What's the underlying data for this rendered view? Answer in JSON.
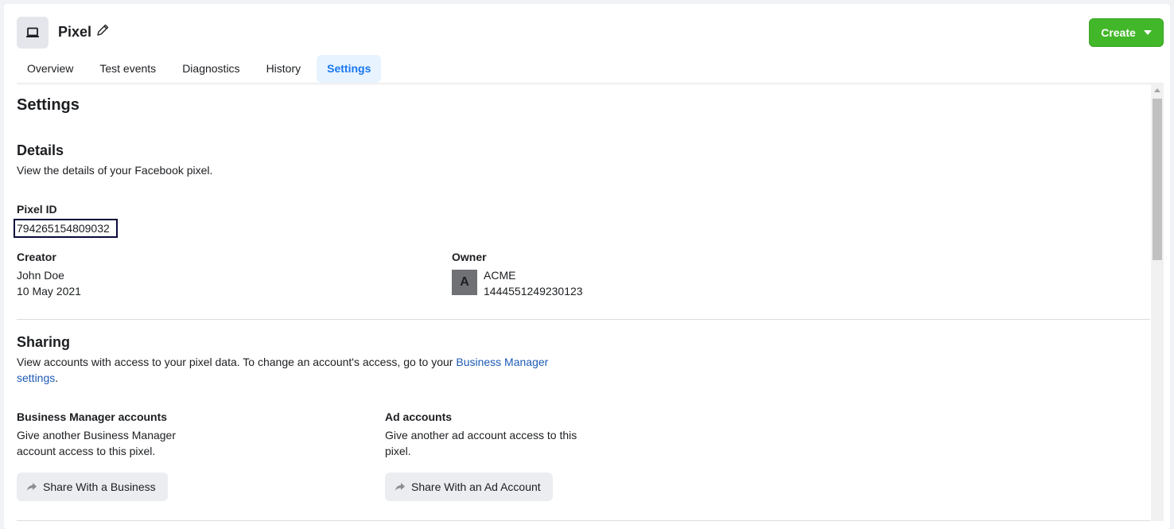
{
  "header": {
    "title": "Pixel",
    "icon": "laptop-icon",
    "create_label": "Create"
  },
  "tabs": [
    {
      "label": "Overview",
      "active": false
    },
    {
      "label": "Test events",
      "active": false
    },
    {
      "label": "Diagnostics",
      "active": false
    },
    {
      "label": "History",
      "active": false
    },
    {
      "label": "Settings",
      "active": true
    }
  ],
  "main": {
    "title": "Settings",
    "details": {
      "heading": "Details",
      "description": "View the details of your Facebook pixel.",
      "pixel_id_label": "Pixel ID",
      "pixel_id_value": "794265154809032",
      "creator_label": "Creator",
      "creator_name": "John Doe",
      "creator_date": "10 May 2021",
      "owner_label": "Owner",
      "owner_initial": "A",
      "owner_name": "ACME",
      "owner_id": "1444551249230123"
    },
    "sharing": {
      "heading": "Sharing",
      "description": "View accounts with access to your pixel data. To change an account's access, go to your ",
      "link_text": "Business Manager settings",
      "description_end": ".",
      "bm_label": "Business Manager accounts",
      "bm_desc": "Give another Business Manager account access to this pixel.",
      "bm_button": "Share With a Business",
      "ad_label": "Ad accounts",
      "ad_desc": "Give another ad account access to this pixel.",
      "ad_button": "Share With an Ad Account"
    }
  },
  "colors": {
    "accent": "#1877f2",
    "create_green": "#42b72a",
    "link": "#1d5bb5"
  }
}
